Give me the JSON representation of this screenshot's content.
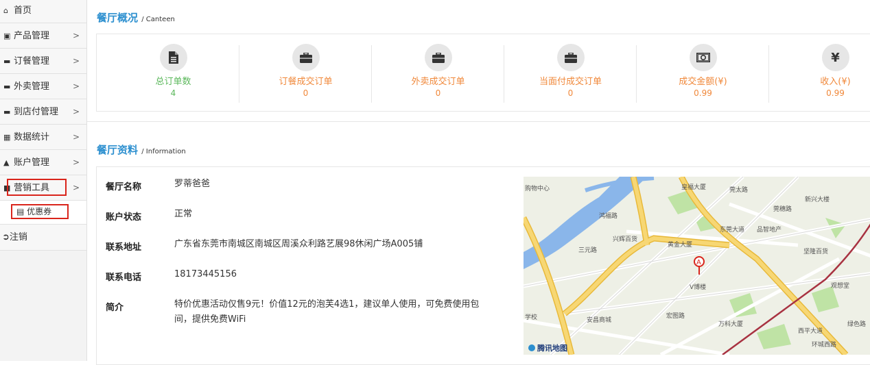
{
  "sidebar": {
    "items": [
      {
        "label": "首页",
        "icon": "home-icon"
      },
      {
        "label": "产品管理",
        "icon": "cart-icon"
      },
      {
        "label": "订餐管理",
        "icon": "briefcase-icon"
      },
      {
        "label": "外卖管理",
        "icon": "briefcase-icon"
      },
      {
        "label": "到店付管理",
        "icon": "briefcase-icon"
      },
      {
        "label": "数据统计",
        "icon": "table-icon"
      },
      {
        "label": "账户管理",
        "icon": "user-icon"
      },
      {
        "label": "营销工具",
        "icon": "puzzle-icon"
      }
    ],
    "sub_item": {
      "label": "优惠券",
      "icon": "file-icon"
    },
    "logout": {
      "label": "注销",
      "icon": "signout-icon"
    },
    "chevron": ">"
  },
  "overview": {
    "title": "餐厅概况",
    "subtitle": "/ Canteen",
    "stats": [
      {
        "label": "总订单数",
        "value": "4",
        "icon": "file-icon",
        "color": "#5cb85c"
      },
      {
        "label": "订餐成交订单",
        "value": "0",
        "icon": "briefcase-icon",
        "color": "#f0883a"
      },
      {
        "label": "外卖成交订单",
        "value": "0",
        "icon": "briefcase-icon",
        "color": "#f0883a"
      },
      {
        "label": "当面付成交订单",
        "value": "0",
        "icon": "briefcase-icon",
        "color": "#f0883a"
      },
      {
        "label": "成交金额(¥)",
        "value": "0.99",
        "icon": "money-icon",
        "color": "#f0883a"
      },
      {
        "label": "收入(¥)",
        "value": "0.99",
        "icon": "yen-icon",
        "color": "#f0883a"
      }
    ]
  },
  "info": {
    "title": "餐厅资料",
    "subtitle": "/ Information",
    "rows": [
      {
        "key": "餐厅名称",
        "value": "罗蒂爸爸"
      },
      {
        "key": "账户状态",
        "value": "正常"
      },
      {
        "key": "联系地址",
        "value": "广东省东莞市南城区南城区周溪众利路艺展98休闲广场A005铺"
      },
      {
        "key": "联系电话",
        "value": "18173445156"
      },
      {
        "key": "简介",
        "value": "特价优惠活动仅售9元！价值12元的泡芙4选1，建议单人使用，可免费使用包间，提供免费WiFi"
      }
    ]
  },
  "map": {
    "marker": "A",
    "logo": "腾讯地图",
    "labels": [
      "皇福大厦",
      "莞太路",
      "新兴大楼",
      "品智地产",
      "黄金大厦",
      "兴辉百货",
      "坚隆百货",
      "V博楼",
      "观想堂",
      "安昌商城",
      "万科大厦",
      "东莞大道",
      "西平大道",
      "购物中心",
      "学校",
      "鸿福路",
      "宏图路",
      "环城西路",
      "莞穗路",
      "三元路",
      "绿色路"
    ]
  },
  "colors": {
    "accent": "#2c8fcf",
    "highlight": "#d9241b",
    "green": "#5cb85c",
    "orange": "#f0883a"
  }
}
